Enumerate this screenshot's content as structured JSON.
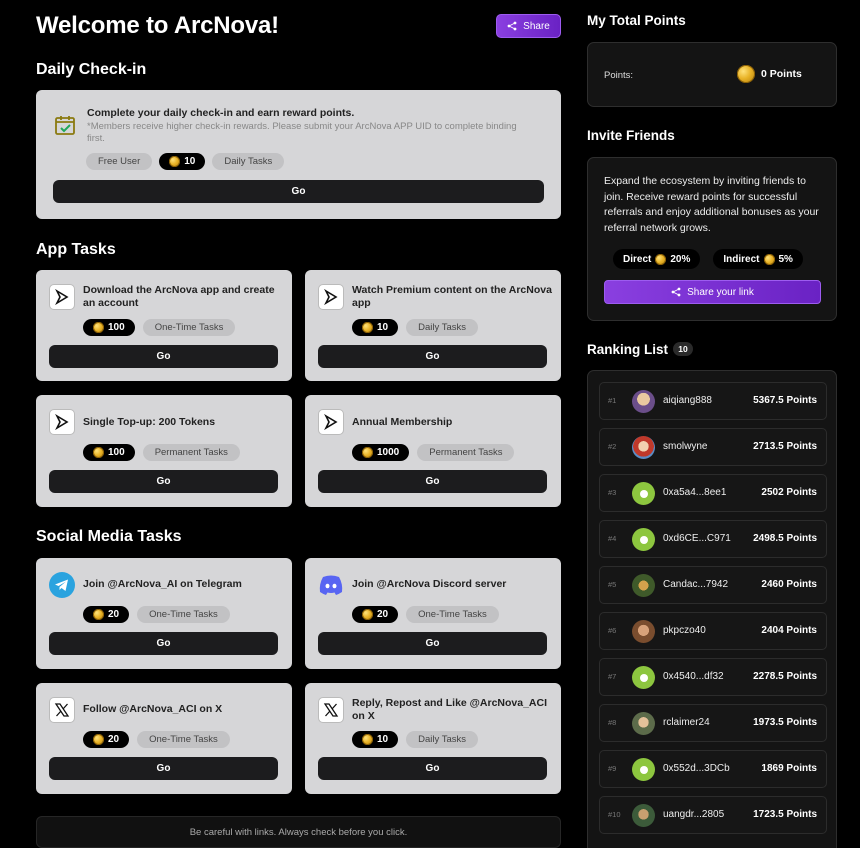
{
  "header": {
    "title": "Welcome to ArcNova!",
    "share_label": "Share"
  },
  "checkin": {
    "section_title": "Daily Check-in",
    "heading": "Complete your daily check-in and earn reward points.",
    "note": "*Members receive higher check-in rewards. Please submit your ArcNova APP UID to complete binding first.",
    "tag_user": "Free User",
    "points": "10",
    "tag_type": "Daily Tasks",
    "go_label": "Go"
  },
  "app_tasks": {
    "section_title": "App Tasks",
    "items": [
      {
        "title": "Download the ArcNova app and create an account",
        "points": "100",
        "type": "One-Time Tasks",
        "go": "Go"
      },
      {
        "title": "Watch Premium content on the ArcNova app",
        "points": "10",
        "type": "Daily Tasks",
        "go": "Go"
      },
      {
        "title": "Single Top-up: 200 Tokens",
        "points": "100",
        "type": "Permanent Tasks",
        "go": "Go"
      },
      {
        "title": "Annual Membership",
        "points": "1000",
        "type": "Permanent Tasks",
        "go": "Go"
      }
    ]
  },
  "social_tasks": {
    "section_title": "Social Media Tasks",
    "items": [
      {
        "title": "Join @ArcNova_AI on Telegram",
        "points": "20",
        "type": "One-Time Tasks",
        "go": "Go",
        "icon": "telegram-icon"
      },
      {
        "title": "Join @ArcNova Discord server",
        "points": "20",
        "type": "One-Time Tasks",
        "go": "Go",
        "icon": "discord-icon"
      },
      {
        "title": "Follow @ArcNova_ACI on X",
        "points": "20",
        "type": "One-Time Tasks",
        "go": "Go",
        "icon": "x-icon"
      },
      {
        "title": "Reply, Repost and Like @ArcNova_ACI on X",
        "points": "10",
        "type": "Daily Tasks",
        "go": "Go",
        "icon": "x-icon"
      }
    ]
  },
  "footer": {
    "note": "Be careful with links. Always check before you click."
  },
  "total_points": {
    "section_title": "My Total Points",
    "label": "Points:",
    "value": "0 Points"
  },
  "invite": {
    "section_title": "Invite Friends",
    "description": "Expand the ecosystem by inviting friends to join. Receive reward points for successful referrals and enjoy additional bonuses as your referral network grows.",
    "direct_label": "Direct",
    "direct_rate": "20%",
    "indirect_label": "Indirect",
    "indirect_rate": "5%",
    "share_link_label": "Share your link"
  },
  "ranking": {
    "section_title": "Ranking List",
    "count": "10",
    "rows": [
      {
        "rank": "#1",
        "name": "aiqiang888",
        "points": "5367.5 Points"
      },
      {
        "rank": "#2",
        "name": "smolwyne",
        "points": "2713.5 Points"
      },
      {
        "rank": "#3",
        "name": "0xa5a4...8ee1",
        "points": "2502 Points"
      },
      {
        "rank": "#4",
        "name": "0xd6CE...C971",
        "points": "2498.5 Points"
      },
      {
        "rank": "#5",
        "name": "Candac...7942",
        "points": "2460 Points"
      },
      {
        "rank": "#6",
        "name": "pkpczo40",
        "points": "2404 Points"
      },
      {
        "rank": "#7",
        "name": "0x4540...df32",
        "points": "2278.5 Points"
      },
      {
        "rank": "#8",
        "name": "rclaimer24",
        "points": "1973.5 Points"
      },
      {
        "rank": "#9",
        "name": "0x552d...3DCb",
        "points": "1869 Points"
      },
      {
        "rank": "#10",
        "name": "uangdr...2805",
        "points": "1723.5 Points"
      }
    ]
  },
  "colors": {
    "accent": "#7b2fd6",
    "card": "#d6d6d8",
    "coin": "#e8b226"
  }
}
